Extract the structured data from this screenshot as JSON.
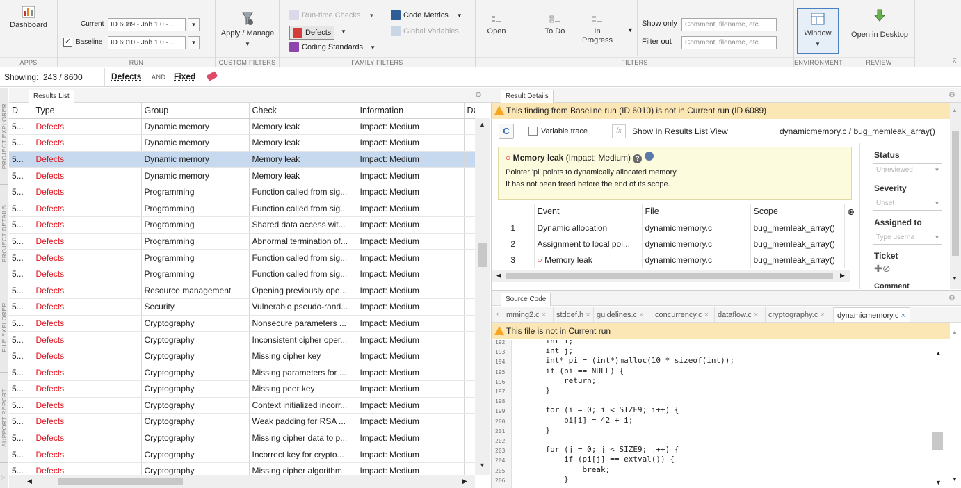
{
  "ribbon": {
    "apps": {
      "dashboard_label": "Dashboard",
      "group_label": "APPS"
    },
    "run": {
      "current_label": "Current",
      "current_value": "ID 6089 - Job 1.0 - ...",
      "baseline_label": "Baseline",
      "baseline_value": "ID 6010 - Job 1.0 - ...",
      "baseline_checked": "✓",
      "group_label": "RUN"
    },
    "custom_filters": {
      "apply_label": "Apply / Manage",
      "group_label": "CUSTOM FILTERS"
    },
    "family_filters": {
      "runtime_checks": "Run-time Checks",
      "defects": "Defects",
      "coding_standards": "Coding Standards",
      "code_metrics": "Code Metrics",
      "global_variables": "Global Variables",
      "group_label": "FAMILY FILTERS"
    },
    "filters": {
      "open": "Open",
      "todo": "To Do",
      "in_progress_1": "In",
      "in_progress_2": "Progress",
      "show_only_label": "Show only",
      "show_only_placeholder": "Comment, filename, etc.",
      "filter_out_label": "Filter out",
      "filter_out_placeholder": "Comment, filename, etc.",
      "group_label": "FILTERS"
    },
    "environment": {
      "window_label": "Window",
      "group_label": "ENVIRONMENT"
    },
    "review": {
      "open_desktop_label": "Open in Desktop",
      "group_label": "REVIEW"
    }
  },
  "status": {
    "showing_label": "Showing:",
    "count": "243 / 8600",
    "chip1": "Defects",
    "and": "AND",
    "chip2": "Fixed"
  },
  "vtabs": [
    "PROJECT EXPLORER",
    "PROJECT DETAILS",
    "FILE EXPLORER",
    "SUPPORT REPORT"
  ],
  "results": {
    "tab_label": "Results List",
    "columns": [
      "D",
      "Type",
      "Group",
      "Check",
      "Information",
      "DO"
    ],
    "rows": [
      {
        "id": "5...",
        "type": "Defects",
        "group": "Dynamic memory",
        "check": "Memory leak",
        "info": "Impact: Medium"
      },
      {
        "id": "5...",
        "type": "Defects",
        "group": "Dynamic memory",
        "check": "Memory leak",
        "info": "Impact: Medium"
      },
      {
        "id": "5...",
        "type": "Defects",
        "group": "Dynamic memory",
        "check": "Memory leak",
        "info": "Impact: Medium"
      },
      {
        "id": "5...",
        "type": "Defects",
        "group": "Dynamic memory",
        "check": "Memory leak",
        "info": "Impact: Medium"
      },
      {
        "id": "5...",
        "type": "Defects",
        "group": "Programming",
        "check": "Function called from sig...",
        "info": "Impact: Medium"
      },
      {
        "id": "5...",
        "type": "Defects",
        "group": "Programming",
        "check": "Function called from sig...",
        "info": "Impact: Medium"
      },
      {
        "id": "5...",
        "type": "Defects",
        "group": "Programming",
        "check": "Shared data access wit...",
        "info": "Impact: Medium"
      },
      {
        "id": "5...",
        "type": "Defects",
        "group": "Programming",
        "check": "Abnormal termination of...",
        "info": "Impact: Medium"
      },
      {
        "id": "5...",
        "type": "Defects",
        "group": "Programming",
        "check": "Function called from sig...",
        "info": "Impact: Medium"
      },
      {
        "id": "5...",
        "type": "Defects",
        "group": "Programming",
        "check": "Function called from sig...",
        "info": "Impact: Medium"
      },
      {
        "id": "5...",
        "type": "Defects",
        "group": "Resource management",
        "check": "Opening previously ope...",
        "info": "Impact: Medium"
      },
      {
        "id": "5...",
        "type": "Defects",
        "group": "Security",
        "check": "Vulnerable pseudo-rand...",
        "info": "Impact: Medium"
      },
      {
        "id": "5...",
        "type": "Defects",
        "group": "Cryptography",
        "check": "Nonsecure parameters ...",
        "info": "Impact: Medium"
      },
      {
        "id": "5...",
        "type": "Defects",
        "group": "Cryptography",
        "check": "Inconsistent cipher oper...",
        "info": "Impact: Medium"
      },
      {
        "id": "5...",
        "type": "Defects",
        "group": "Cryptography",
        "check": "Missing cipher key",
        "info": "Impact: Medium"
      },
      {
        "id": "5...",
        "type": "Defects",
        "group": "Cryptography",
        "check": "Missing parameters for ...",
        "info": "Impact: Medium"
      },
      {
        "id": "5...",
        "type": "Defects",
        "group": "Cryptography",
        "check": "Missing peer key",
        "info": "Impact: Medium"
      },
      {
        "id": "5...",
        "type": "Defects",
        "group": "Cryptography",
        "check": "Context initialized incorr...",
        "info": "Impact: Medium"
      },
      {
        "id": "5...",
        "type": "Defects",
        "group": "Cryptography",
        "check": "Weak padding for RSA ...",
        "info": "Impact: Medium"
      },
      {
        "id": "5...",
        "type": "Defects",
        "group": "Cryptography",
        "check": "Missing cipher data to p...",
        "info": "Impact: Medium"
      },
      {
        "id": "5...",
        "type": "Defects",
        "group": "Cryptography",
        "check": "Incorrect key for crypto...",
        "info": "Impact: Medium"
      },
      {
        "id": "5...",
        "type": "Defects",
        "group": "Cryptography",
        "check": "Missing cipher algorithm",
        "info": "Impact: Medium"
      }
    ]
  },
  "details": {
    "tab_label": "Result Details",
    "warning": "This finding from Baseline run (ID 6010) is not in Current run (ID 6089)",
    "variable_trace": "Variable trace",
    "fx": "fx",
    "show_in_list": "Show In Results List View",
    "location": "dynamicmemory.c / bug_memleak_array()",
    "finding_title": "Memory leak",
    "finding_impact": "(Impact: Medium)",
    "finding_line1": "Pointer 'pi' points to dynamically allocated memory.",
    "finding_line2": "It has not been freed before the end of its scope.",
    "events_columns": [
      "Event",
      "File",
      "Scope"
    ],
    "events": [
      {
        "n": "1",
        "event": "Dynamic allocation",
        "file": "dynamicmemory.c",
        "scope": "bug_memleak_array()"
      },
      {
        "n": "2",
        "event": "Assignment to local poi...",
        "file": "dynamicmemory.c",
        "scope": "bug_memleak_array()"
      },
      {
        "n": "3",
        "event": "Memory leak",
        "file": "dynamicmemory.c",
        "scope": "bug_memleak_array()"
      }
    ],
    "side": {
      "status_label": "Status",
      "status_value": "Unreviewed",
      "severity_label": "Severity",
      "severity_value": "Unset",
      "assigned_label": "Assigned to",
      "assigned_placeholder": "Type userna",
      "ticket_label": "Ticket",
      "comment_label": "Comment"
    }
  },
  "source": {
    "tab_label": "Source Code",
    "file_tabs": [
      "mming2.c",
      "stddef.h",
      "guidelines.c",
      "concurrency.c",
      "dataflow.c",
      "cryptography.c",
      "dynamicmemory.c"
    ],
    "warning": "This file is not in Current run",
    "lines": [
      {
        "n": "192",
        "code": "    int i;"
      },
      {
        "n": "193",
        "code": "    int j;"
      },
      {
        "n": "194",
        "code": "    int* pi = (int*)malloc(10 * sizeof(int));"
      },
      {
        "n": "195",
        "code": "    if (pi == NULL) {"
      },
      {
        "n": "196",
        "code": "        return;"
      },
      {
        "n": "197",
        "code": "    }"
      },
      {
        "n": "198",
        "code": ""
      },
      {
        "n": "199",
        "code": "    for (i = 0; i < SIZE9; i++) {"
      },
      {
        "n": "200",
        "code": "        pi[i] = 42 + i;"
      },
      {
        "n": "201",
        "code": "    }"
      },
      {
        "n": "202",
        "code": ""
      },
      {
        "n": "203",
        "code": "    for (j = 0; j < SIZE9; j++) {"
      },
      {
        "n": "204",
        "code": "        if (pi[j] == extval()) {"
      },
      {
        "n": "205",
        "code": "            break;"
      },
      {
        "n": "206",
        "code": "        }"
      }
    ]
  }
}
